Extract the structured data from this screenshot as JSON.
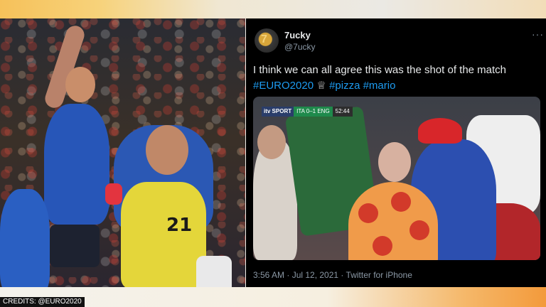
{
  "tweet": {
    "display_name": "7ucky",
    "handle": "@7ucky",
    "text": "I think we can all agree this was the shot of the match",
    "hashtag_1": "#EURO2020",
    "hashtag_2": "#pizza",
    "hashtag_3": "#mario",
    "timestamp": "3:56 AM · Jul 12, 2021 · Twitter for iPhone",
    "more_glyph": "···",
    "avatar_glyph": "7"
  },
  "scoreboard": {
    "channel": "itv SPORT",
    "teams": "ITA 0–1 ENG",
    "clock": "52:44"
  },
  "photo": {
    "jersey_number": "21"
  },
  "credits": {
    "text": "CREDITS: @EURO2020"
  },
  "colors": {
    "tweet_background": "#000000",
    "link": "#1d9bf0",
    "muted": "#8b98a5"
  },
  "icons": {
    "trophy": "trophy-icon",
    "more": "more-options-icon"
  }
}
